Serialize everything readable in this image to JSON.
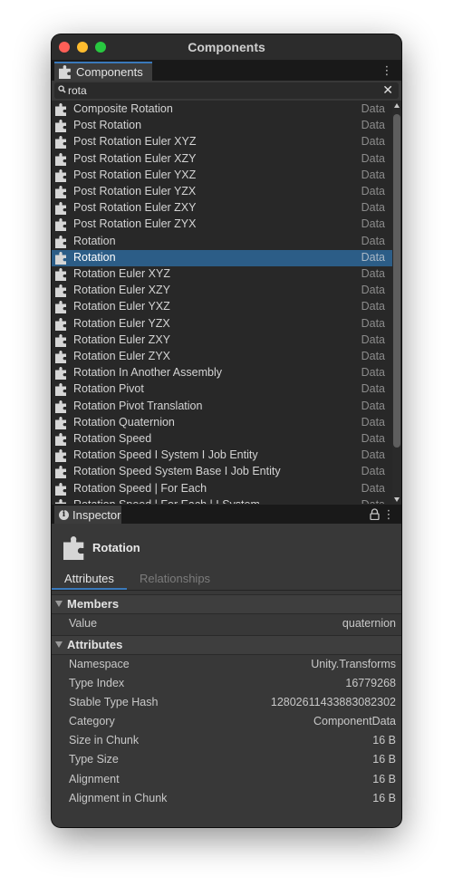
{
  "window": {
    "title": "Components"
  },
  "components_tab": {
    "label": "Components"
  },
  "search": {
    "value": "rota"
  },
  "components": [
    {
      "name": "Composite Rotation",
      "kind": "Data",
      "selected": false
    },
    {
      "name": "Post Rotation",
      "kind": "Data",
      "selected": false
    },
    {
      "name": "Post Rotation Euler XYZ",
      "kind": "Data",
      "selected": false
    },
    {
      "name": "Post Rotation Euler XZY",
      "kind": "Data",
      "selected": false
    },
    {
      "name": "Post Rotation Euler YXZ",
      "kind": "Data",
      "selected": false
    },
    {
      "name": "Post Rotation Euler YZX",
      "kind": "Data",
      "selected": false
    },
    {
      "name": "Post Rotation Euler ZXY",
      "kind": "Data",
      "selected": false
    },
    {
      "name": "Post Rotation Euler ZYX",
      "kind": "Data",
      "selected": false
    },
    {
      "name": "Rotation",
      "kind": "Data",
      "selected": false
    },
    {
      "name": "Rotation",
      "kind": "Data",
      "selected": true
    },
    {
      "name": "Rotation Euler XYZ",
      "kind": "Data",
      "selected": false
    },
    {
      "name": "Rotation Euler XZY",
      "kind": "Data",
      "selected": false
    },
    {
      "name": "Rotation Euler YXZ",
      "kind": "Data",
      "selected": false
    },
    {
      "name": "Rotation Euler YZX",
      "kind": "Data",
      "selected": false
    },
    {
      "name": "Rotation Euler ZXY",
      "kind": "Data",
      "selected": false
    },
    {
      "name": "Rotation Euler ZYX",
      "kind": "Data",
      "selected": false
    },
    {
      "name": "Rotation In Another Assembly",
      "kind": "Data",
      "selected": false
    },
    {
      "name": "Rotation Pivot",
      "kind": "Data",
      "selected": false
    },
    {
      "name": "Rotation Pivot Translation",
      "kind": "Data",
      "selected": false
    },
    {
      "name": "Rotation Quaternion",
      "kind": "Data",
      "selected": false
    },
    {
      "name": "Rotation Speed",
      "kind": "Data",
      "selected": false
    },
    {
      "name": "Rotation Speed I System I Job Entity",
      "kind": "Data",
      "selected": false
    },
    {
      "name": "Rotation Speed System Base I Job Entity",
      "kind": "Data",
      "selected": false
    },
    {
      "name": "Rotation Speed | For Each",
      "kind": "Data",
      "selected": false
    },
    {
      "name": "Rotation Speed | For Each | I System",
      "kind": "Data",
      "selected": false
    }
  ],
  "inspector": {
    "tab_label": "Inspector",
    "component_title": "Rotation",
    "tabs": {
      "attributes": "Attributes",
      "relationships": "Relationships"
    },
    "members_header": "Members",
    "members": [
      {
        "key": "Value",
        "value": "quaternion"
      }
    ],
    "attributes_header": "Attributes",
    "attributes": [
      {
        "key": "Namespace",
        "value": "Unity.Transforms"
      },
      {
        "key": "Type Index",
        "value": "16779268"
      },
      {
        "key": "Stable Type Hash",
        "value": "12802611433883082302"
      },
      {
        "key": "Category",
        "value": "ComponentData"
      },
      {
        "key": "Size in Chunk",
        "value": "16 B"
      },
      {
        "key": "Type Size",
        "value": "16 B"
      },
      {
        "key": "Alignment",
        "value": "16 B"
      },
      {
        "key": "Alignment in Chunk",
        "value": "16 B"
      }
    ]
  }
}
